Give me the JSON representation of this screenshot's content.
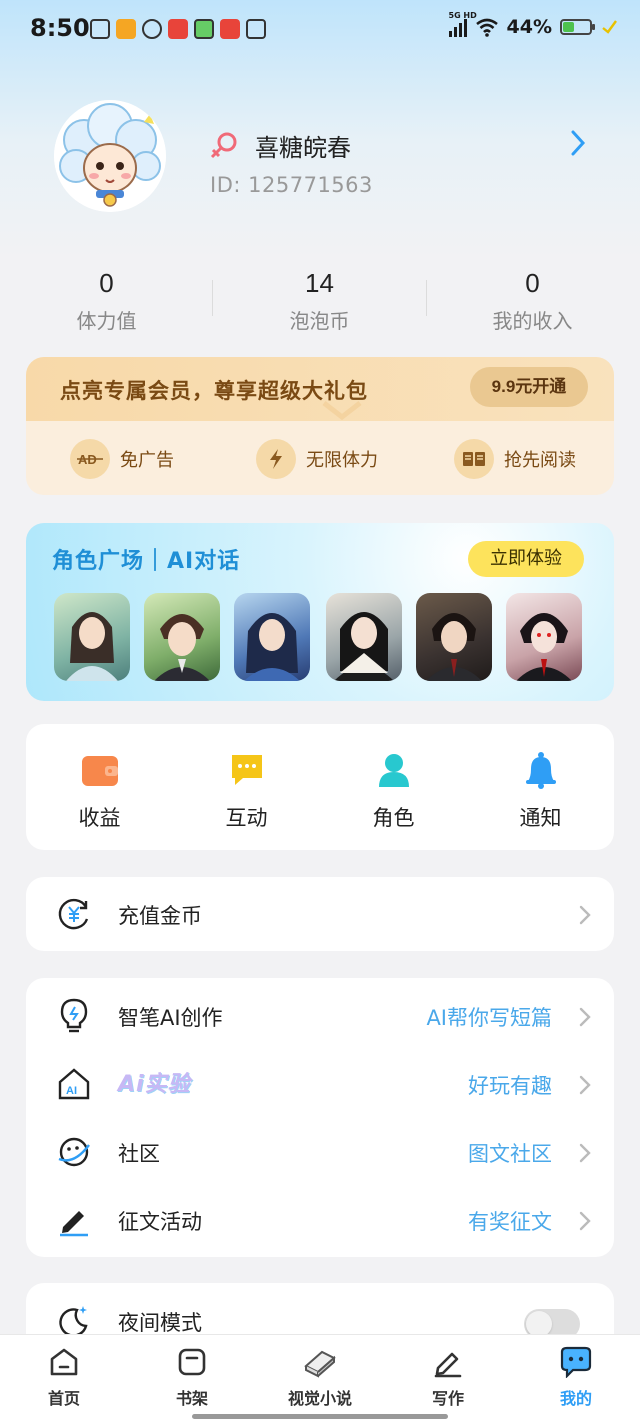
{
  "status_bar": {
    "time": "8:50",
    "network": "5G HD",
    "battery_percent": "44%",
    "battery_level": 0.44
  },
  "profile": {
    "nickname": "喜糖皖春",
    "id_label": "ID:",
    "id_value": "125771563"
  },
  "stats": [
    {
      "value": "0",
      "label": "体力值"
    },
    {
      "value": "14",
      "label": "泡泡币"
    },
    {
      "value": "0",
      "label": "我的收入"
    }
  ],
  "vip": {
    "title": "点亮专属会员，尊享超级大礼包",
    "button": "9.9元开通",
    "benefits": [
      {
        "icon": "ad-icon",
        "label": "免广告"
      },
      {
        "icon": "lightning-icon",
        "label": "无限体力"
      },
      {
        "icon": "book-icon",
        "label": "抢先阅读"
      }
    ]
  },
  "role_card": {
    "title": "角色广场｜AI对话",
    "button": "立即体验"
  },
  "tools": [
    {
      "icon": "wallet-icon",
      "label": "收益",
      "color": "#f7874b"
    },
    {
      "icon": "chat-icon",
      "label": "互动",
      "color": "#f5c518"
    },
    {
      "icon": "person-icon",
      "label": "角色",
      "color": "#28c8cf"
    },
    {
      "icon": "bell-icon",
      "label": "通知",
      "color": "#2f9ef5"
    }
  ],
  "recharge": {
    "label": "充值金币"
  },
  "features": [
    {
      "label": "智笔AI创作",
      "sub": "AI帮你写短篇"
    },
    {
      "label": "Ai实验",
      "sub": "好玩有趣"
    },
    {
      "label": "社区",
      "sub": "图文社区"
    },
    {
      "label": "征文活动",
      "sub": "有奖征文"
    }
  ],
  "night_mode": {
    "label": "夜间模式",
    "enabled": false
  },
  "nav": [
    {
      "icon": "home-icon",
      "label": "首页"
    },
    {
      "icon": "bookshelf-icon",
      "label": "书架"
    },
    {
      "icon": "visual-novel-icon",
      "label": "视觉小说"
    },
    {
      "icon": "pen-icon",
      "label": "写作"
    },
    {
      "icon": "mine-icon",
      "label": "我的",
      "active": true
    }
  ],
  "colors": {
    "accent": "#2f9ef5",
    "vip_text": "#7a4a14",
    "sub_text": "#4aa8ea"
  }
}
